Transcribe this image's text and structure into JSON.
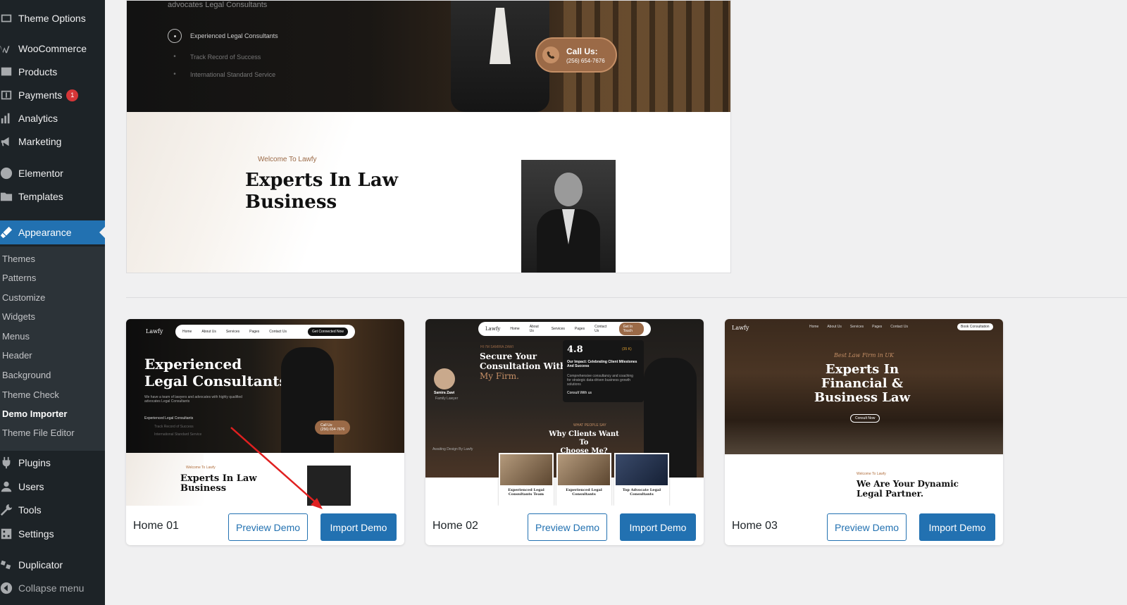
{
  "sidebar": {
    "items": [
      {
        "label": "Theme Options",
        "icon": "theme-options-icon"
      },
      {
        "label": "WooCommerce",
        "icon": "woocommerce-icon"
      },
      {
        "label": "Products",
        "icon": "products-icon"
      },
      {
        "label": "Payments",
        "icon": "payments-icon",
        "badge": "1"
      },
      {
        "label": "Analytics",
        "icon": "analytics-icon"
      },
      {
        "label": "Marketing",
        "icon": "marketing-icon"
      },
      {
        "label": "Elementor",
        "icon": "elementor-icon"
      },
      {
        "label": "Templates",
        "icon": "templates-icon"
      },
      {
        "label": "Appearance",
        "icon": "appearance-icon",
        "active": true
      },
      {
        "label": "Plugins",
        "icon": "plugins-icon"
      },
      {
        "label": "Users",
        "icon": "users-icon"
      },
      {
        "label": "Tools",
        "icon": "tools-icon"
      },
      {
        "label": "Settings",
        "icon": "settings-icon"
      },
      {
        "label": "Duplicator",
        "icon": "duplicator-icon"
      },
      {
        "label": "Collapse menu",
        "icon": "collapse-icon"
      }
    ],
    "submenu": [
      {
        "label": "Themes"
      },
      {
        "label": "Patterns"
      },
      {
        "label": "Customize"
      },
      {
        "label": "Widgets"
      },
      {
        "label": "Menus"
      },
      {
        "label": "Header"
      },
      {
        "label": "Background"
      },
      {
        "label": "Theme Check"
      },
      {
        "label": "Demo Importer",
        "current": true
      },
      {
        "label": "Theme File Editor"
      }
    ]
  },
  "preview": {
    "hero_subtitle": "advocates Legal Consultants",
    "list": [
      "Experienced Legal Consultants",
      "Track Record of Success",
      "International Standard Service"
    ],
    "call_label": "Call Us:",
    "call_number": "(256) 654-7676",
    "welcome": "Welcome To Lawfy",
    "title_line1": "Experts In Law",
    "title_line2": "Business"
  },
  "demos": [
    {
      "name": "Home 01",
      "preview_label": "Preview Demo",
      "import_label": "Import Demo",
      "thumb": {
        "logo": "Lawfy",
        "nav": [
          "Home",
          "About Us",
          "Services",
          "Pages",
          "Contact Us"
        ],
        "cta": "Get Connected Now",
        "title_line1": "Experienced",
        "title_line2": "Legal Consultants",
        "desc": "We have a team of lawyers and advocates with highly qualified advocates Legal Consultants",
        "list": [
          "Experienced Legal Consultants",
          "Track Record of Success",
          "International Standard Service"
        ],
        "call_label": "Call Us:",
        "call_number": "(256) 654-7676",
        "welcome": "Welcome To Lawfy",
        "sec_title_line1": "Experts In Law",
        "sec_title_line2": "Business"
      }
    },
    {
      "name": "Home 02",
      "preview_label": "Preview Demo",
      "import_label": "Import Demo",
      "thumb": {
        "logo": "Lawfy",
        "nav": [
          "Home",
          "About Us",
          "Services",
          "Pages",
          "Contact Us"
        ],
        "cta": "Get In Touch",
        "kicker": "HI I'M SAMIRA ZAWI",
        "title_line1": "Secure Your",
        "title_line2": "Consultation With",
        "title_line3": "My Firm.",
        "person_name": "Samira Zawi",
        "person_role": "Family Lawyer",
        "rating": "4.8",
        "rating_sub": "(35 K)",
        "impact_title": "Our Impact: Celebrating Client Milestones And Success",
        "impact_desc": "Comprehensive consultancy and coaching for strategic data-driven business growth solutions",
        "consult": "Consult With us",
        "footer_small": "Awaiting Design By Lawfy",
        "section_kicker": "WHAT PEOPLE SAY",
        "section_title_line1": "Why Clients Want To",
        "section_title_line2": "Choose Me?",
        "cards": [
          "Experienced Legal Consultants Team",
          "Experienced Legal Consultants",
          "Top Advocate Legal Consultants"
        ]
      }
    },
    {
      "name": "Home 03",
      "preview_label": "Preview Demo",
      "import_label": "Import Demo",
      "thumb": {
        "logo": "Lawfy",
        "nav": [
          "Home",
          "About Us",
          "Services",
          "Pages",
          "Contact Us"
        ],
        "cta": "Book Consultation",
        "kicker": "Best Law Firm in UK",
        "title_line1": "Experts In",
        "title_line2": "Financial &",
        "title_line3": "Business Law",
        "btn": "Consult Now",
        "welcome": "Welcome To Lawfy",
        "sec_title_line1": "We Are Your Dynamic",
        "sec_title_line2": "Legal Partner."
      }
    }
  ],
  "colors": {
    "sidebar_bg": "#1d2327",
    "submenu_bg": "#2c3338",
    "accent": "#2271b1",
    "badge": "#d63638",
    "annotation_arrow": "#e02020"
  }
}
